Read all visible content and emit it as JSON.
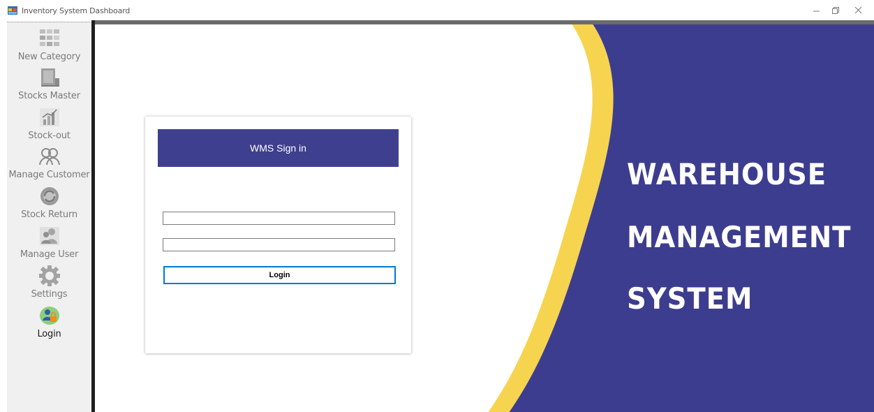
{
  "window": {
    "title": "Inventory System Dashboard",
    "controls": [
      "minimize",
      "restore",
      "close"
    ]
  },
  "sidebar": {
    "items": [
      {
        "label": "New Category",
        "icon": "category-grid-icon",
        "active": false
      },
      {
        "label": "Stocks Master",
        "icon": "stock-box-icon",
        "active": false
      },
      {
        "label": "Stock-out",
        "icon": "chart-icon",
        "active": false
      },
      {
        "label": "Manage Customer",
        "icon": "customers-icon",
        "active": false
      },
      {
        "label": "Stock Return",
        "icon": "return-icon",
        "active": false
      },
      {
        "label": "Manage User",
        "icon": "users-icon",
        "active": false
      },
      {
        "label": "Settings",
        "icon": "gear-icon",
        "active": false
      },
      {
        "label": "Login",
        "icon": "user-lock-icon",
        "active": true
      }
    ]
  },
  "login": {
    "header": "WMS Sign in",
    "username_value": "",
    "password_value": "",
    "button_label": "Login"
  },
  "banner": {
    "lines": [
      "WAREHOUSE",
      "MANAGEMENT",
      "SYSTEM"
    ]
  },
  "colors": {
    "brand_navy": "#3f3f8f",
    "accent_yellow": "#f6d44f",
    "focus_blue": "#0078d7",
    "sidebar_bg": "#f0f0f0"
  }
}
